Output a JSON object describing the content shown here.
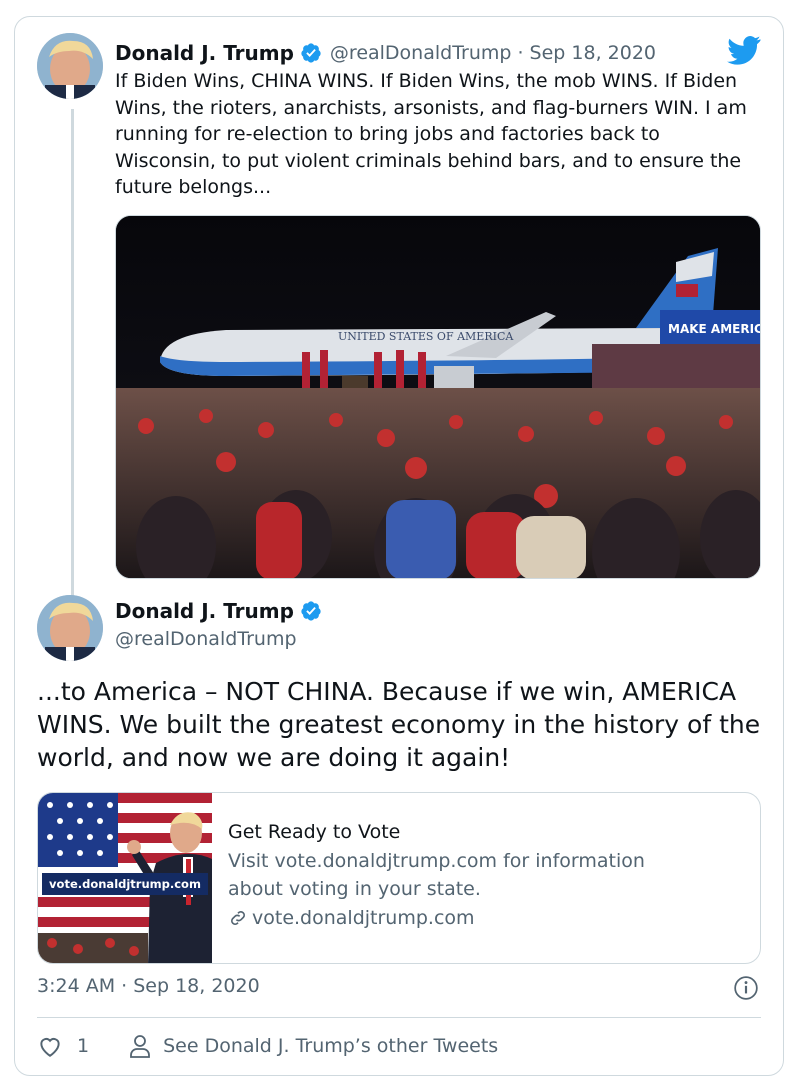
{
  "colors": {
    "accent": "#1d9bf0",
    "text": "#0f1419",
    "secondary": "#536471",
    "border": "#cfd9de"
  },
  "icons": {
    "brand": "twitter-bird-icon",
    "verified": "verified-badge-icon",
    "info": "info-icon",
    "like": "heart-icon",
    "profile": "person-icon",
    "link": "link-icon"
  },
  "tweet1": {
    "name": "Donald J. Trump",
    "handle_date": "@realDonaldTrump · Sep 18, 2020",
    "text": "If Biden Wins, CHINA WINS. If Biden Wins, the mob WINS. If Biden Wins, the rioters, anarchists, arsonists, and flag-burners WIN. I am running for re-election to bring jobs and factories back to Wisconsin, to put violent criminals behind bars, and to ensure the future belongs...",
    "photo_sign": "MAKE AMERICA",
    "photo_plane_text": "UNITED STATES OF AMERICA"
  },
  "tweet2": {
    "name": "Donald J. Trump",
    "handle": "@realDonaldTrump",
    "text": "...to America – NOT CHINA. Because if we win, AMERICA WINS. We built the greatest economy in the history of the world, and now we are doing it again!"
  },
  "link_card": {
    "thumb_label": "vote.donaldjtrump.com",
    "title": "Get Ready to Vote",
    "description": "Visit vote.donaldjtrump.com for information about voting in your state.",
    "url": "vote.donaldjtrump.com"
  },
  "footer": {
    "timestamp": "3:24 AM · Sep 18, 2020",
    "like_count": "1",
    "other_tweets": "See Donald J. Trump’s other Tweets"
  }
}
